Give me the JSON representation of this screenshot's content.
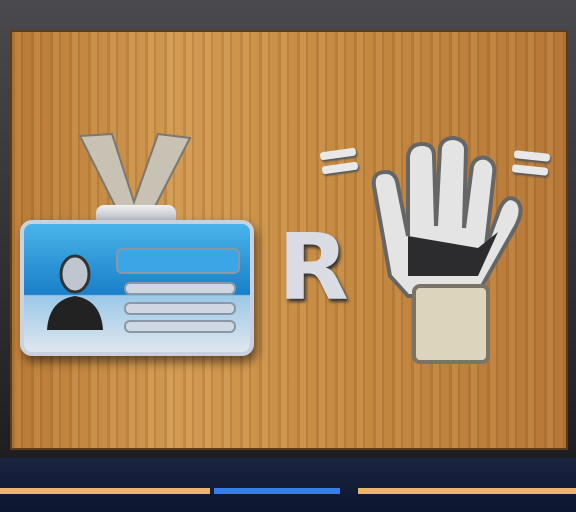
{
  "scene": {
    "letter": "R",
    "icons": [
      "id-badge-icon",
      "person-icon",
      "glove-icon",
      "equals-icon"
    ],
    "colors": {
      "wood": "#c58a42",
      "badge_blue": "#1a7fc8",
      "frame": "#2b2a2c",
      "accent_blue": "#2f6fd8"
    }
  }
}
